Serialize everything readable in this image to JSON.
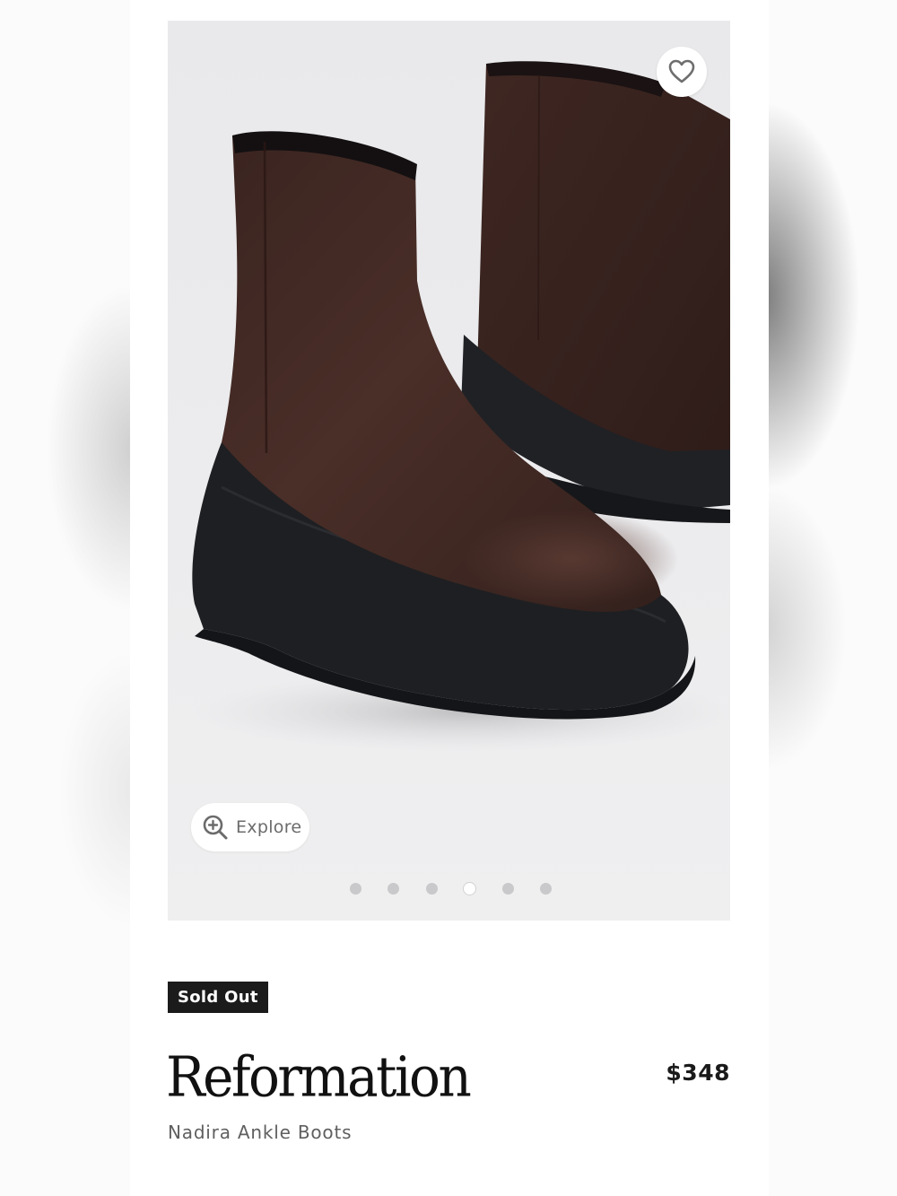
{
  "product": {
    "brand": "Reformation",
    "name": "Nadira Ankle Boots",
    "price": "$348",
    "badge": "Sold Out",
    "image_alt": "Brown suede ankle boots with black platform sole"
  },
  "gallery": {
    "explore_label": "Explore",
    "image_count": 6,
    "active_index": 3
  },
  "icons": {
    "favorite": "heart-outline-icon",
    "explore": "zoom-in-icon"
  },
  "colors": {
    "suede": "#3c2520",
    "sole": "#1e1f22",
    "badge_bg": "#1b1b1b"
  }
}
